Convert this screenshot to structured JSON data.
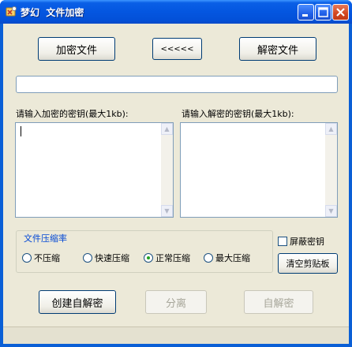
{
  "window": {
    "title": "梦幻  文件加密",
    "icon": "app-icon"
  },
  "titlebar_buttons": {
    "minimize": "minimize-icon",
    "maximize": "maximize-icon",
    "close": "close-icon"
  },
  "top_buttons": {
    "encrypt_file": "加密文件",
    "back": "<<<<<",
    "decrypt_file": "解密文件"
  },
  "file_path": {
    "value": ""
  },
  "encrypt_key": {
    "label": "请输入加密的密钥(最大1kb):",
    "value": ""
  },
  "decrypt_key": {
    "label": "请输入解密的密钥(最大1kb):",
    "value": ""
  },
  "compression": {
    "title": "文件压缩率",
    "options": [
      "不压缩",
      "快速压缩",
      "正常压缩",
      "最大压缩"
    ],
    "selected": "正常压缩"
  },
  "hide_key": {
    "label": "屏蔽密钥",
    "checked": false
  },
  "clear_clipboard": "清空剪贴板",
  "bottom_buttons": {
    "create_self_decrypt": "创建自解密",
    "split": "分离",
    "self_decrypt": "自解密"
  },
  "colors": {
    "titlebar": "#0350d8",
    "client": "#ece9d8",
    "group_title": "#0046d5",
    "radio_dot": "#21a121"
  }
}
